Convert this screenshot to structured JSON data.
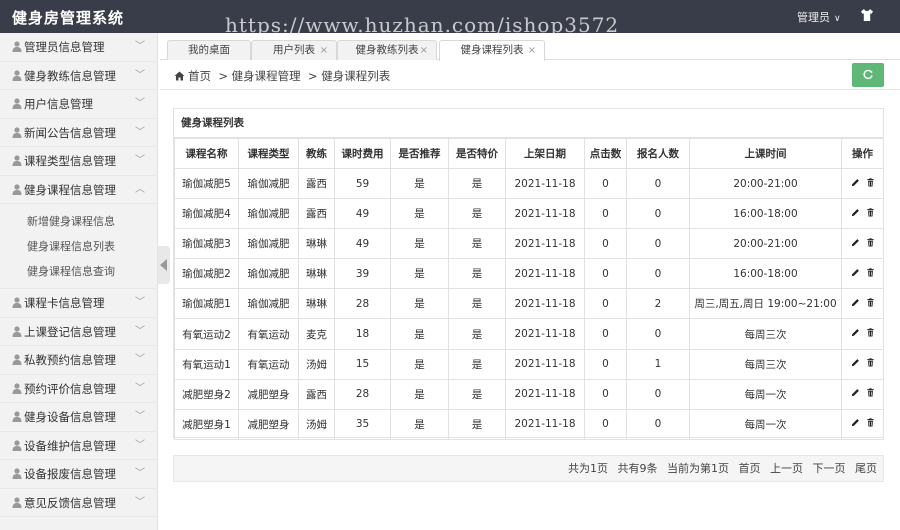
{
  "header": {
    "title": "健身房管理系统",
    "watermark": "https://www.huzhan.com/ishop3572",
    "user": "管理员"
  },
  "sidebar": {
    "items": [
      {
        "label": "管理员信息管理",
        "arrow": "﹀"
      },
      {
        "label": "健身教练信息管理",
        "arrow": "﹀"
      },
      {
        "label": "用户信息管理",
        "arrow": "﹀"
      },
      {
        "label": "新闻公告信息管理",
        "arrow": "﹀"
      },
      {
        "label": "课程类型信息管理",
        "arrow": "﹀"
      },
      {
        "label": "健身课程信息管理",
        "arrow": "︿"
      },
      {
        "label": "课程卡信息管理",
        "arrow": "﹀"
      },
      {
        "label": "上课登记信息管理",
        "arrow": "﹀"
      },
      {
        "label": "私教预约信息管理",
        "arrow": "﹀"
      },
      {
        "label": "预约评价信息管理",
        "arrow": "﹀"
      },
      {
        "label": "健身设备信息管理",
        "arrow": "﹀"
      },
      {
        "label": "设备维护信息管理",
        "arrow": "﹀"
      },
      {
        "label": "设备报废信息管理",
        "arrow": "﹀"
      },
      {
        "label": "意见反馈信息管理",
        "arrow": "﹀"
      }
    ],
    "submenu": [
      "新增健身课程信息",
      "健身课程信息列表",
      "健身课程信息查询"
    ]
  },
  "tabs": [
    {
      "label": "我的桌面",
      "close": ""
    },
    {
      "label": "用户列表",
      "close": "×"
    },
    {
      "label": "健身教练列表",
      "close": "×"
    },
    {
      "label": "健身课程列表",
      "close": "×"
    }
  ],
  "breadcrumb": {
    "home": "首页",
    "sep": ">",
    "level1": "健身课程管理",
    "level2": "健身课程列表"
  },
  "panel": {
    "title": "健身课程列表",
    "columns": [
      "课程名称",
      "课程类型",
      "教练",
      "课时费用",
      "是否推荐",
      "是否特价",
      "上架日期",
      "点击数",
      "报名人数",
      "上课时间",
      "操作"
    ],
    "rows": [
      [
        "瑜伽减肥5",
        "瑜伽减肥",
        "露西",
        "59",
        "是",
        "是",
        "2021-11-18",
        "0",
        "0",
        "20:00-21:00"
      ],
      [
        "瑜伽减肥4",
        "瑜伽减肥",
        "露西",
        "49",
        "是",
        "是",
        "2021-11-18",
        "0",
        "0",
        "16:00-18:00"
      ],
      [
        "瑜伽减肥3",
        "瑜伽减肥",
        "琳琳",
        "49",
        "是",
        "是",
        "2021-11-18",
        "0",
        "0",
        "20:00-21:00"
      ],
      [
        "瑜伽减肥2",
        "瑜伽减肥",
        "琳琳",
        "39",
        "是",
        "是",
        "2021-11-18",
        "0",
        "0",
        "16:00-18:00"
      ],
      [
        "瑜伽减肥1",
        "瑜伽减肥",
        "琳琳",
        "28",
        "是",
        "是",
        "2021-11-18",
        "0",
        "2",
        "周三,周五,周日 19:00~21:00"
      ],
      [
        "有氧运动2",
        "有氧运动",
        "麦克",
        "18",
        "是",
        "是",
        "2021-11-18",
        "0",
        "0",
        "每周三次"
      ],
      [
        "有氧运动1",
        "有氧运动",
        "汤姆",
        "15",
        "是",
        "是",
        "2021-11-18",
        "0",
        "1",
        "每周三次"
      ],
      [
        "减肥塑身2",
        "减肥塑身",
        "露西",
        "28",
        "是",
        "是",
        "2021-11-18",
        "0",
        "0",
        "每周一次"
      ],
      [
        "减肥塑身1",
        "减肥塑身",
        "汤姆",
        "35",
        "是",
        "是",
        "2021-11-18",
        "0",
        "0",
        "每周一次"
      ]
    ]
  },
  "pager": {
    "total_pages": "共为1页",
    "total_items": "共有9条",
    "current": "当前为第1页",
    "first": "首页",
    "prev": "上一页",
    "next": "下一页",
    "last": "尾页"
  },
  "colors": {
    "header_bg": "#393d49",
    "refresh_btn": "#5fb878"
  }
}
